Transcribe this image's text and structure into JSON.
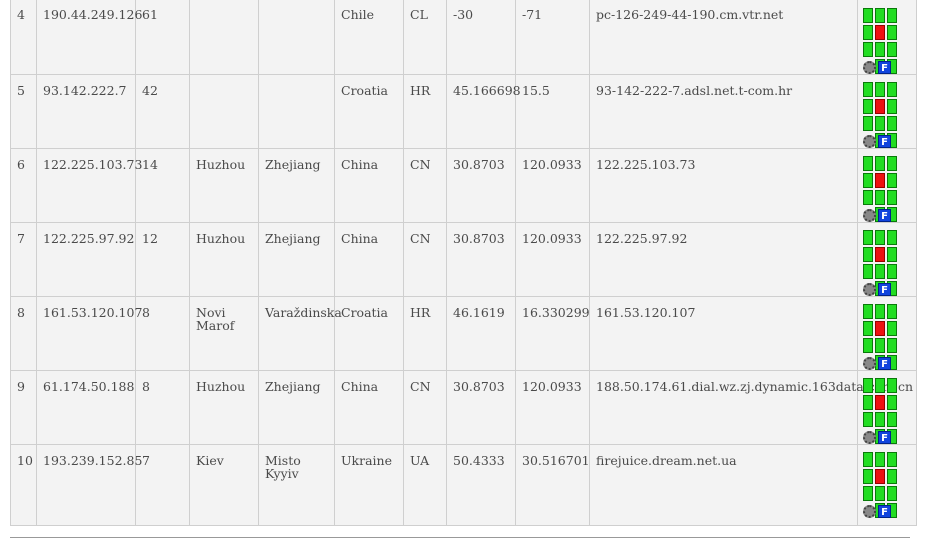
{
  "rows": [
    {
      "rank": "4",
      "ip": "190.44.249.126",
      "hits": "61",
      "city": "",
      "region": "",
      "country": "Chile",
      "code": "CL",
      "lat": "-30",
      "lon": "-71",
      "host": "pc-126-249-44-190.cm.vtr.net"
    },
    {
      "rank": "5",
      "ip": "93.142.222.7",
      "hits": "42",
      "city": "",
      "region": "",
      "country": "Croatia",
      "code": "HR",
      "lat": "45.166698",
      "lon": "15.5",
      "host": "93-142-222-7.adsl.net.t-com.hr"
    },
    {
      "rank": "6",
      "ip": "122.225.103.73",
      "hits": "14",
      "city": "Huzhou",
      "region": "Zhejiang",
      "country": "China",
      "code": "CN",
      "lat": "30.8703",
      "lon": "120.0933",
      "host": "122.225.103.73"
    },
    {
      "rank": "7",
      "ip": "122.225.97.92",
      "hits": "12",
      "city": "Huzhou",
      "region": "Zhejiang",
      "country": "China",
      "code": "CN",
      "lat": "30.8703",
      "lon": "120.0933",
      "host": "122.225.97.92"
    },
    {
      "rank": "8",
      "ip": "161.53.120.107",
      "hits": "8",
      "city": "Novi Marof",
      "region": "Varaždinska",
      "country": "Croatia",
      "code": "HR",
      "lat": "46.1619",
      "lon": "16.330299",
      "host": "161.53.120.107"
    },
    {
      "rank": "9",
      "ip": "61.174.50.188",
      "hits": "8",
      "city": "Huzhou",
      "region": "Zhejiang",
      "country": "China",
      "code": "CN",
      "lat": "30.8703",
      "lon": "120.0933",
      "host": "188.50.174.61.dial.wz.zj.dynamic.163data.com.cn"
    },
    {
      "rank": "10",
      "ip": "193.239.152.85",
      "hits": "7",
      "city": "Kiev",
      "region": "Misto Kyyiv",
      "country": "Ukraine",
      "code": "UA",
      "lat": "50.4333",
      "lon": "30.516701",
      "host": "firejuice.dream.net.ua"
    }
  ],
  "icons": {
    "grid": "map-grid-icon",
    "tool": "gear-icon",
    "flag": "f-icon",
    "flag_letter": "F",
    "colors": {
      "green": "#22dd22",
      "red": "#ee1111",
      "blue": "#1144dd"
    }
  }
}
